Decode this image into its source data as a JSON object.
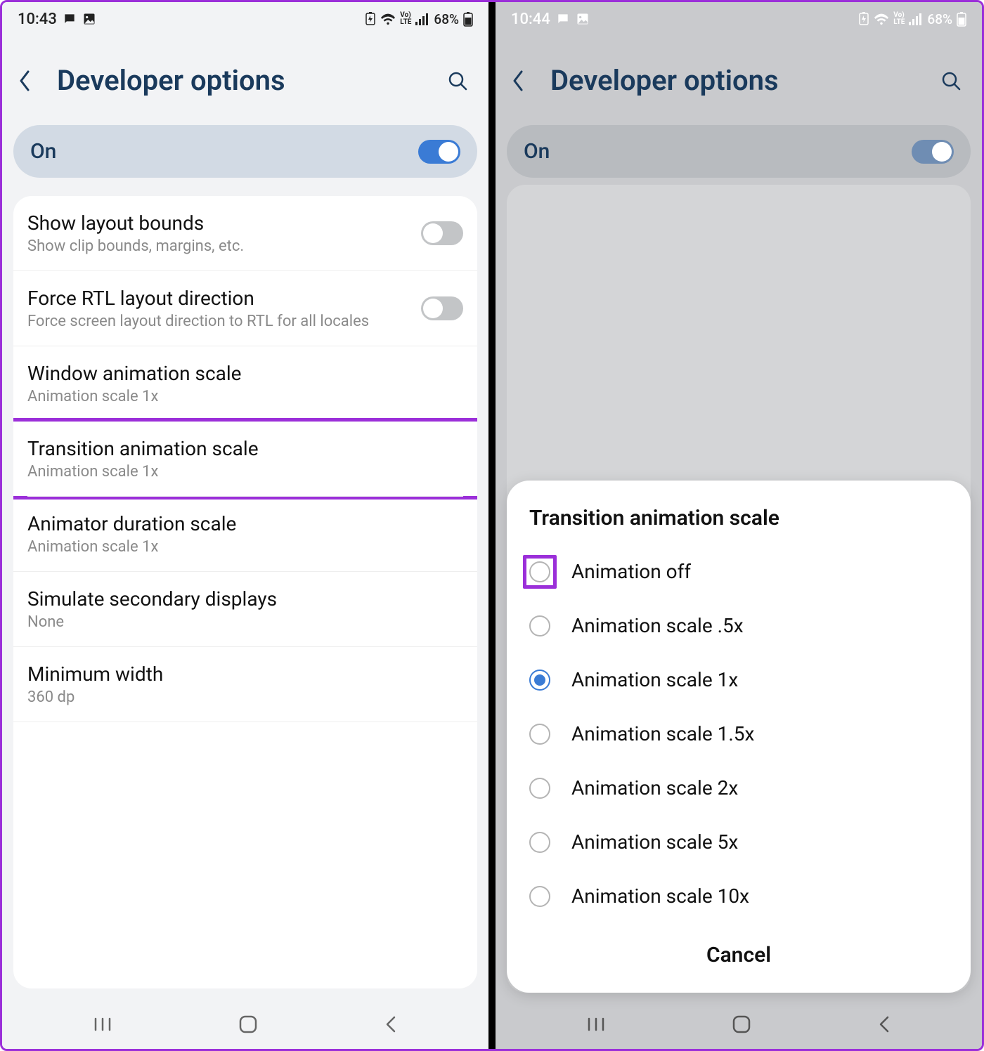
{
  "left": {
    "status": {
      "time": "10:43",
      "battery": "68%"
    },
    "header": {
      "title": "Developer options"
    },
    "toggle": {
      "label": "On"
    },
    "settings": [
      {
        "title": "Show layout bounds",
        "sub": "Show clip bounds, margins, etc.",
        "switch": true
      },
      {
        "title": "Force RTL layout direction",
        "sub": "Force screen layout direction to RTL for all locales",
        "switch": true
      },
      {
        "title": "Window animation scale",
        "sub": "Animation scale 1x"
      },
      {
        "title": "Transition animation scale",
        "sub": "Animation scale 1x",
        "highlight": true
      },
      {
        "title": "Animator duration scale",
        "sub": "Animation scale 1x"
      },
      {
        "title": "Simulate secondary displays",
        "sub": "None"
      },
      {
        "title": "Minimum width",
        "sub": "360 dp"
      }
    ],
    "cutoff": ""
  },
  "right": {
    "status": {
      "time": "10:44",
      "battery": "68%"
    },
    "header": {
      "title": "Developer options"
    },
    "toggle": {
      "label": "On"
    },
    "dialog": {
      "title": "Transition animation scale",
      "options": [
        "Animation off",
        "Animation scale .5x",
        "Animation scale 1x",
        "Animation scale 1.5x",
        "Animation scale 2x",
        "Animation scale 5x",
        "Animation scale 10x"
      ],
      "selected_index": 2,
      "highlight_index": 0,
      "cancel": "Cancel"
    }
  }
}
